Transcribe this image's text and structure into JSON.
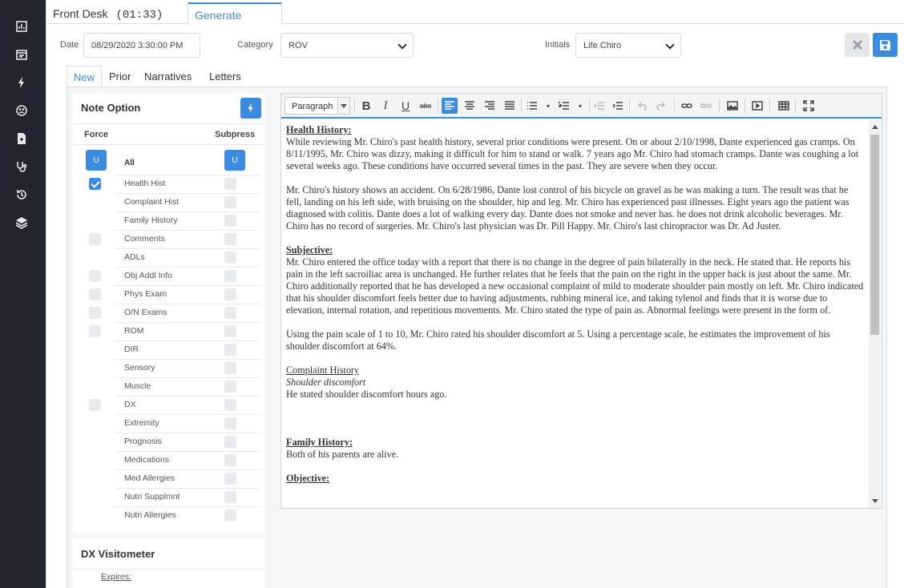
{
  "tabs": {
    "front_desk": "Front Desk",
    "clock": "(01:33)",
    "generate": "Generate"
  },
  "form": {
    "date_label": "Date",
    "date_value": "08/29/2020 3:30:00 PM",
    "category_label": "Category",
    "category_value": "ROV",
    "initials_label": "Initials",
    "initials_value": "Life Chiro"
  },
  "subtabs": [
    "New",
    "Prior",
    "Narratives",
    "Letters"
  ],
  "note_option": {
    "title": "Note Option",
    "force_label": "Force",
    "suppress_label": "Subpress",
    "u_label": "U",
    "all_label": "All",
    "items": [
      {
        "label": "Health Hist",
        "force": true,
        "force_box": true
      },
      {
        "label": "Complaint Hist",
        "force": false,
        "force_box": false
      },
      {
        "label": "Family History",
        "force": false,
        "force_box": false
      },
      {
        "label": "Comments",
        "force": false,
        "force_box": true
      },
      {
        "label": "ADLs",
        "force": false,
        "force_box": false
      },
      {
        "label": "Obj Addl Info",
        "force": false,
        "force_box": true
      },
      {
        "label": "Phys Exam",
        "force": false,
        "force_box": true
      },
      {
        "label": "O/N Exams",
        "force": false,
        "force_box": true
      },
      {
        "label": "ROM",
        "force": false,
        "force_box": true
      },
      {
        "label": "DIR",
        "force": false,
        "force_box": false
      },
      {
        "label": "Sensory",
        "force": false,
        "force_box": false
      },
      {
        "label": "Muscle",
        "force": false,
        "force_box": false
      },
      {
        "label": "DX",
        "force": false,
        "force_box": true
      },
      {
        "label": "Extremity",
        "force": false,
        "force_box": false
      },
      {
        "label": "Prognosis",
        "force": false,
        "force_box": false
      },
      {
        "label": "Medications",
        "force": false,
        "force_box": false
      },
      {
        "label": "Med Allergies",
        "force": false,
        "force_box": false
      },
      {
        "label": "Nutri Supplmnt",
        "force": false,
        "force_box": false
      },
      {
        "label": "Nutri Allergies",
        "force": false,
        "force_box": false
      }
    ]
  },
  "dx_visitometer": {
    "title": "DX Visitometer",
    "expires": "Expires:"
  },
  "editor": {
    "paragraph_format": "Paragraph",
    "content": [
      {
        "type": "h",
        "text": "Health History:"
      },
      {
        "type": "p",
        "text": "While reviewing Mr. Chiro's past health history, several prior conditions were present. On or about 2/10/1998, Dante experienced gas cramps. On 8/11/1995, Mr. Chiro was dizzy, making it difficult for him to stand or walk. 7 years ago Mr. Chiro had stomach cramps. Dante was coughing a lot several weeks ago. These conditions have occurred several times in the past. They are severe when they occur."
      },
      {
        "type": "gap"
      },
      {
        "type": "p",
        "text": "Mr. Chiro's history shows an accident. On 6/28/1986, Dante lost control of his bicycle on gravel as he was making a turn. The result was that he fell, landing on his left side, with bruising on the shoulder, hip and leg. Mr. Chiro has experienced past illnesses. Eight years ago the patient was diagnosed with colitis. Dante does a lot of walking every day. Dante does not smoke and never has. he does not drink alcoholic beverages. Mr. Chiro has no record of surgeries. Mr. Chiro's last physician was Dr. Pill Happy. Mr. Chiro's last chiropractor was Dr. Ad Juster."
      },
      {
        "type": "gap"
      },
      {
        "type": "h",
        "text": "Subjective:"
      },
      {
        "type": "p",
        "text": "Mr. Chiro entered the office today with a report that there is no change in the degree of pain bilaterally in the neck. He stated that. He reports his pain in the left sacroiliac area is unchanged. He further relates that he feels that the pain on the right in the upper back is just about the same. Mr. Chiro additionally reported that he has developed a new occasional complaint of mild to moderate shoulder pain mostly on left. Mr. Chiro indicated that his shoulder discomfort feels better due to having adjustments, rubbing mineral ice, and taking tylenol and finds that it is worse due to elevation, internal rotation, and repetitious movements. Mr. Chiro stated the type of pain as. Abnormal feelings were present in the form of."
      },
      {
        "type": "gap"
      },
      {
        "type": "p",
        "text": "Using the pain scale of 1 to 10, Mr. Chiro rated his shoulder discomfort at 5. Using a percentage scale, he estimates the improvement of his shoulder discomfort at 64%."
      },
      {
        "type": "gap"
      },
      {
        "type": "u",
        "text": "Complaint History "
      },
      {
        "type": "i",
        "text": "Shoulder discomfort"
      },
      {
        "type": "p",
        "text": "He stated shoulder discomfort hours ago."
      },
      {
        "type": "gap"
      },
      {
        "type": "gap"
      },
      {
        "type": "gap"
      },
      {
        "type": "h",
        "text": "Family History: "
      },
      {
        "type": "p",
        "text": "Both of his parents are alive."
      },
      {
        "type": "gap"
      },
      {
        "type": "h",
        "text": "Objective:"
      }
    ]
  }
}
